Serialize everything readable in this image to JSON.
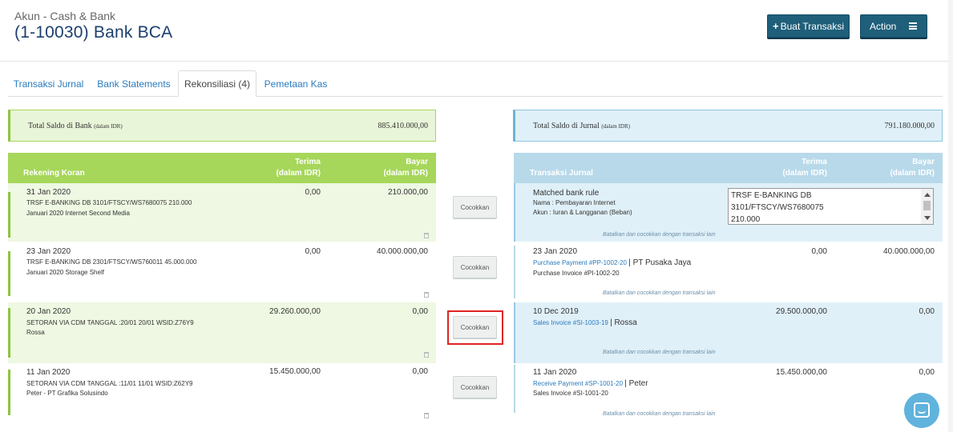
{
  "header": {
    "subtitle": "Akun - Cash & Bank",
    "title": "(1-10030) Bank BCA",
    "buat_label": "Buat Transaksi",
    "action_label": "Action"
  },
  "tabs": [
    {
      "label": "Transaksi Jurnal"
    },
    {
      "label": "Bank Statements"
    },
    {
      "label": "Rekonsiliasi (4)"
    },
    {
      "label": "Pemetaan Kas"
    }
  ],
  "summary_left": {
    "label": "Total Saldo di Bank",
    "unit": "(dalam IDR)",
    "value": "885.410.000,00"
  },
  "summary_right": {
    "label": "Total Saldo di Jurnal",
    "unit": "(dalam IDR)",
    "value": "791.180.000,00"
  },
  "left_table": {
    "col_title": "Rekening Koran",
    "terima": "Terima",
    "bayar": "Bayar",
    "unit": "(dalam IDR)",
    "rows": [
      {
        "date": "31 Jan 2020",
        "line1": "TRSF E-BANKING DB 3101/FTSCY/WS7680075 210.000",
        "line2": "Januari 2020 Internet Second Media",
        "terima": "0,00",
        "bayar": "210.000,00"
      },
      {
        "date": "23 Jan 2020",
        "line1": "TRSF E-BANKING DB 2301/FTSCY/WS760011 45.000.000",
        "line2": "Januari 2020 Storage Shelf",
        "terima": "0,00",
        "bayar": "40.000.000,00"
      },
      {
        "date": "20 Jan 2020",
        "line1": "SETORAN VIA CDM TANGGAL :20/01 20/01 WSID:Z76Y9",
        "line2": "Rossa",
        "terima": "29.260.000,00",
        "bayar": "0,00"
      },
      {
        "date": "11 Jan 2020",
        "line1": "SETORAN VIA CDM TANGGAL :11/01 11/01 WSID:Z62Y9",
        "line2": "Peter - PT Grafika Solusindo",
        "terima": "15.450.000,00",
        "bayar": "0,00"
      }
    ]
  },
  "cocokkan_label": "Cocokkan",
  "right_table": {
    "col_title": "Transaksi Jurnal",
    "terima": "Terima",
    "bayar": "Bayar",
    "unit": "(dalam IDR)",
    "batal": "Batalkan dan cocokkan dengan transaksi lain",
    "matched": {
      "title": "Matched bank rule",
      "nama": "Nama : Pembayaran Internet",
      "akun": "Akun : Iuran & Langganan (Beban)",
      "text_l1": "TRSF E-BANKING DB",
      "text_l2": "3101/FTSCY/WS7680075",
      "text_l3": "210.000"
    },
    "rows": [
      {
        "date": "23 Jan 2020",
        "link": "Purchase Payment #PP-1002-20",
        "party": "| PT Pusaka Jaya",
        "sub": "Purchase Invoice #PI-1002-20",
        "terima": "0,00",
        "bayar": "40.000.000,00"
      },
      {
        "date": "10 Dec 2019",
        "link": "Sales Invoice #SI-1003-19",
        "party": "| Rossa",
        "sub": "",
        "terima": "29.500.000,00",
        "bayar": "0,00"
      },
      {
        "date": "11 Jan 2020",
        "link": "Receive Payment #SP-1001-20",
        "party": "| Peter",
        "sub": "Sales Invoice #SI-1001-20",
        "terima": "15.450.000,00",
        "bayar": "0,00"
      }
    ]
  }
}
